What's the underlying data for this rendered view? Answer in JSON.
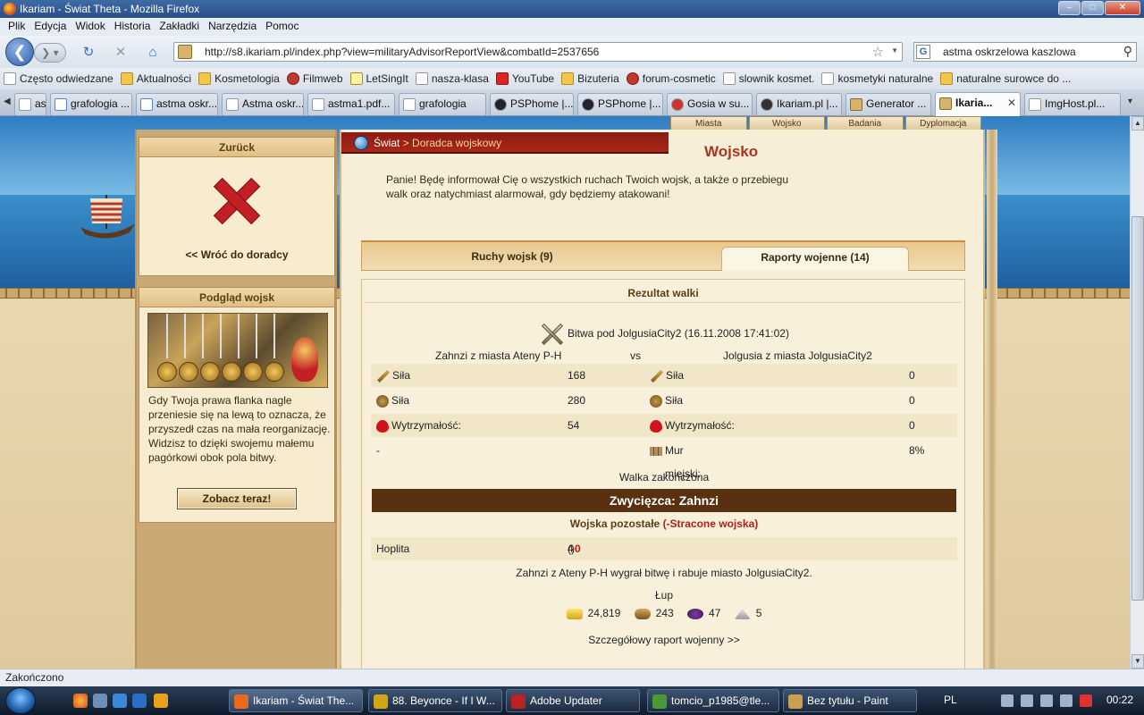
{
  "window": {
    "title": "Ikariam - Świat Theta - Mozilla Firefox",
    "btn_min": "–",
    "btn_max": "□",
    "btn_close": "✕"
  },
  "menu": [
    "Plik",
    "Edycja",
    "Widok",
    "Historia",
    "Zakładki",
    "Narzędzia",
    "Pomoc"
  ],
  "nav": {
    "url": "http://s8.ikariam.pl/index.php?view=militaryAdvisorReportView&combatId=2537656",
    "search_value": "astma oskrzelowa kaszlowa",
    "search_engine": "G"
  },
  "bookmarks": [
    {
      "label": "Często odwiedzane",
      "icon": "page"
    },
    {
      "label": "Aktualności",
      "icon": "feed"
    },
    {
      "label": "Kosmetologia",
      "icon": "folder"
    },
    {
      "label": "Filmweb",
      "icon": "red"
    },
    {
      "label": "LetSingIt",
      "icon": "note"
    },
    {
      "label": "nasza-klasa",
      "icon": "page"
    },
    {
      "label": "YouTube",
      "icon": "yt"
    },
    {
      "label": "Bizuteria",
      "icon": "folder"
    },
    {
      "label": "forum-cosmetic",
      "icon": "red"
    },
    {
      "label": "slownik kosmet.",
      "icon": "page"
    },
    {
      "label": "kosmetyki naturalne",
      "icon": "page"
    },
    {
      "label": "naturalne surowce do ...",
      "icon": "folder"
    }
  ],
  "tabs": [
    {
      "label": "as...",
      "icon": "page"
    },
    {
      "label": "grafologia ...",
      "icon": "g"
    },
    {
      "label": "astma oskr...",
      "icon": "g"
    },
    {
      "label": "Astma oskr...",
      "icon": "page"
    },
    {
      "label": "astma1.pdf...",
      "icon": "page"
    },
    {
      "label": "grafologia",
      "icon": "page"
    },
    {
      "label": "PSPhome |...",
      "icon": "ps"
    },
    {
      "label": "PSPhome |...",
      "icon": "ps"
    },
    {
      "label": "Gosia w su...",
      "icon": "gs"
    },
    {
      "label": "Ikariam.pl |...",
      "icon": "ik2"
    },
    {
      "label": "Generator ...",
      "icon": "ik"
    },
    {
      "label": "Ikaria...",
      "icon": "ik"
    },
    {
      "label": "ImgHost.pl...",
      "icon": "page"
    }
  ],
  "game": {
    "subnav": [
      "Miasta",
      "Wojsko",
      "Badania",
      "Dyplomacja"
    ],
    "breadcrumb": {
      "world": "Świat",
      "sep": " > ",
      "current": "Doradca wojskowy"
    },
    "title": "Wojsko",
    "intro": "Panie! Będę informował Cię o wszystkich ruchach Twoich wojsk, a także o przebiegu walk oraz natychmiast alarmował, gdy będziemy atakowani!",
    "left": {
      "back_header": "Zurück",
      "back_link": "<< Wróć do doradcy",
      "preview_header": "Podgląd wojsk",
      "tip": "Gdy Twoja prawa flanka nagle przeniesie się na lewą to oznacza, że przyszedł czas na mała reorganizację. Widzisz to dzięki swojemu małemu pagórkowi obok pola bitwy.",
      "see_button": "Zobacz teraz!"
    },
    "tabs": {
      "movements": "Ruchy wojsk (9)",
      "reports": "Raporty wojenne (14)"
    },
    "report": {
      "header": "Rezultat walki",
      "battle": "Bitwa pod JolgusiaCity2 (16.11.2008 17:41:02)",
      "attacker": "Zahnzi z miasta Ateny P-H",
      "vs": "vs",
      "defender": "Jolgusia z miasta JolgusiaCity2",
      "stats": [
        {
          "label": "Siła ataku:",
          "icon": "sword-icon",
          "a": "168",
          "d": "0"
        },
        {
          "label": "Siła obrony:",
          "icon": "shield-icon",
          "a": "280",
          "d": "0"
        },
        {
          "label": "Wytrzymałość:",
          "icon": "heart-icon",
          "a": "54",
          "d": "0"
        }
      ],
      "wall_left": "-",
      "wall_label": "Mur miejski:",
      "wall_value": "8%",
      "end": "Walka zakończona",
      "winner": "Zwycięzca: Zahnzi",
      "remain_label": "Wojska pozostałe",
      "remain_lost": "(-Stracone wojska)",
      "unit_name": "Hoplita",
      "unit_count": "4",
      "unit_lost": "-0",
      "summary": "Zahnzi z Ateny P-H wygrał bitwę i rabuje miasto JolgusiaCity2.",
      "loot_label": "Łup",
      "loot": [
        {
          "icon": "gold",
          "value": "24,819"
        },
        {
          "icon": "wood",
          "value": "243"
        },
        {
          "icon": "wine",
          "value": "47"
        },
        {
          "icon": "marble",
          "value": "5"
        }
      ],
      "detail_link": "Szczegółowy raport wojenny >>"
    }
  },
  "status": "Zakończono",
  "taskbar": {
    "items": [
      {
        "label": "Ikariam - Świat The...",
        "color": "#e86a1a"
      },
      {
        "label": "88. Beyonce - If I W...",
        "color": "#d2a418"
      },
      {
        "label": "Adobe Updater",
        "color": "#b22"
      },
      {
        "label": "tomcio_p1985@tle...",
        "color": "#4a9a3a"
      },
      {
        "label": "Bez tytułu - Paint",
        "color": "#caa050"
      }
    ],
    "lang": "PL",
    "time": "00:22"
  }
}
